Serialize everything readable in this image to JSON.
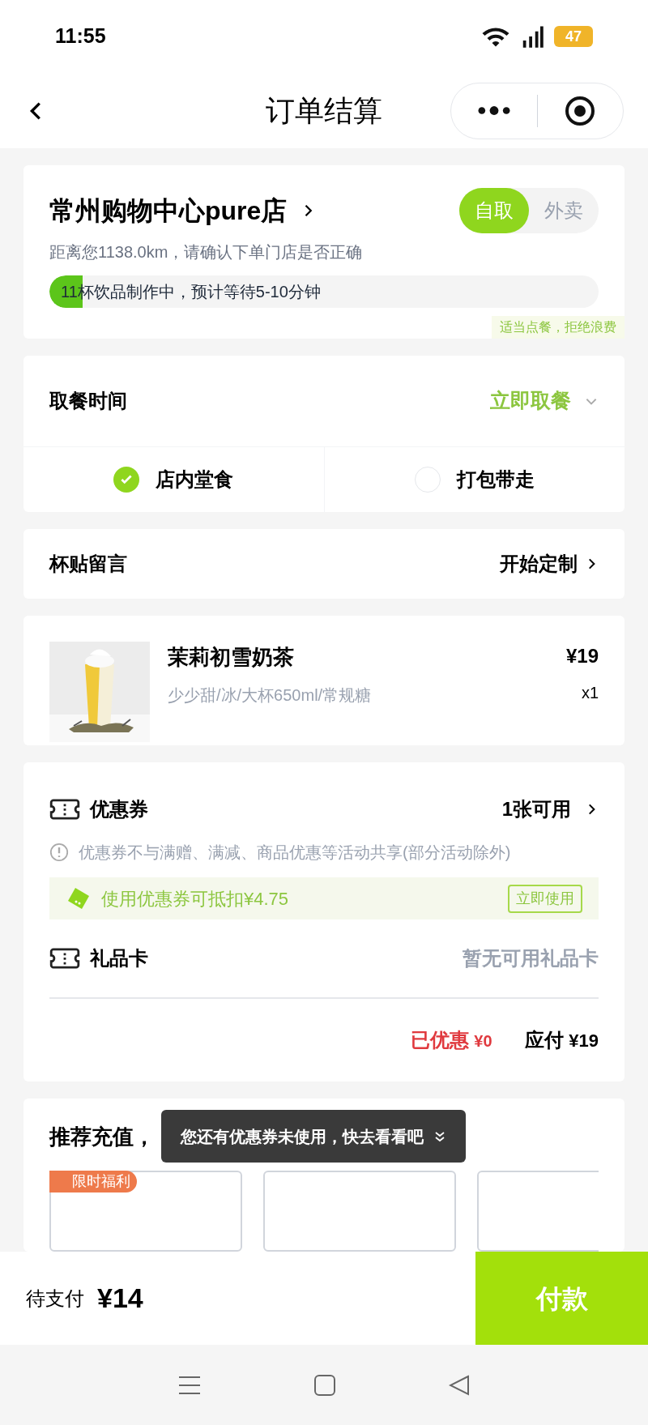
{
  "status_bar": {
    "time": "11:55",
    "battery": "47"
  },
  "nav": {
    "title": "订单结算"
  },
  "store": {
    "name": "常州购物中心pure店",
    "distance": "距离您1138.0km，请确认下单门店是否正确",
    "modes": [
      {
        "label": "自取",
        "selected": true
      },
      {
        "label": "外卖",
        "selected": false
      }
    ],
    "queue": {
      "text": "11杯饮品制作中，预计等待5-10分钟",
      "level": 0.06
    },
    "notice": "适当点餐，拒绝浪费"
  },
  "pickup": {
    "label": "取餐时间",
    "value": "立即取餐",
    "options": [
      {
        "label": "店内堂食",
        "selected": true
      },
      {
        "label": "打包带走",
        "selected": false
      }
    ]
  },
  "sticker": {
    "label": "杯贴留言",
    "action": "开始定制"
  },
  "item": {
    "name": "茉莉初雪奶茶",
    "specs": "少少甜/冰/大杯650ml/常规糖",
    "price": "¥19",
    "quantity": "x1"
  },
  "coupon": {
    "label": "优惠券",
    "value": "1张可用",
    "note": "优惠券不与满赠、满减、商品优惠等活动共享(部分活动除外)",
    "promo": "使用优惠券可抵扣¥4.75",
    "promo_button": "立即使用"
  },
  "gift_card": {
    "label": "礼品卡",
    "value": "暂无可用礼品卡"
  },
  "summary": {
    "discount_label": "已优惠",
    "discount": "¥0",
    "due_label": "应付",
    "due": "¥19"
  },
  "recharge": {
    "title": "推荐充值，",
    "badge": "限时福利"
  },
  "tooltip": {
    "text": "您还有优惠券未使用，快去看看吧"
  },
  "checkout": {
    "label": "待支付",
    "amount": "¥14",
    "button": "付款"
  }
}
